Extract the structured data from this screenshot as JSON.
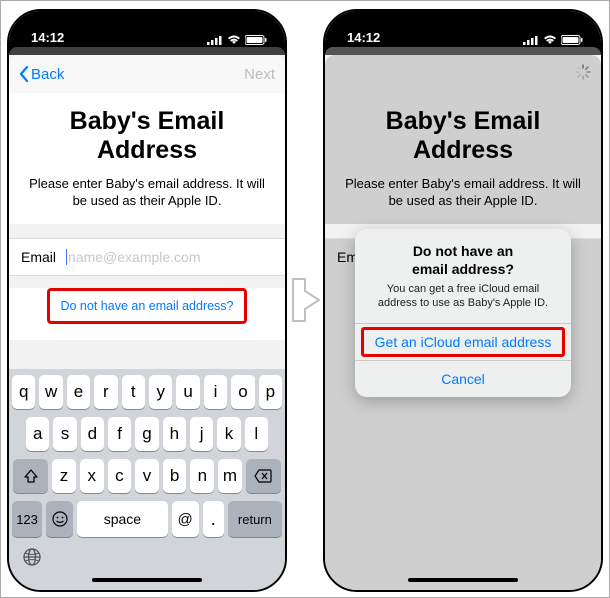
{
  "status": {
    "time": "14:12"
  },
  "nav": {
    "back": "Back",
    "next": "Next"
  },
  "page": {
    "title_line1": "Baby's Email",
    "title_line2": "Address",
    "subtitle": "Please enter Baby's email address. It will be used as their Apple ID."
  },
  "field": {
    "label": "Email",
    "placeholder": "name@example.com"
  },
  "link": {
    "no_email": "Do not have an email address?"
  },
  "keyboard": {
    "row1": [
      "q",
      "w",
      "e",
      "r",
      "t",
      "y",
      "u",
      "i",
      "o",
      "p"
    ],
    "row2": [
      "a",
      "s",
      "d",
      "f",
      "g",
      "h",
      "j",
      "k",
      "l"
    ],
    "row3": [
      "z",
      "x",
      "c",
      "v",
      "b",
      "n",
      "m"
    ],
    "numKey": "123",
    "space": "space",
    "at": "@",
    "dot": ".",
    "return": "return"
  },
  "alert": {
    "title_line1": "Do not have an",
    "title_line2": "email address?",
    "message": "You can get a free iCloud email address to use as Baby's Apple ID.",
    "primary": "Get an iCloud email address",
    "cancel": "Cancel"
  }
}
